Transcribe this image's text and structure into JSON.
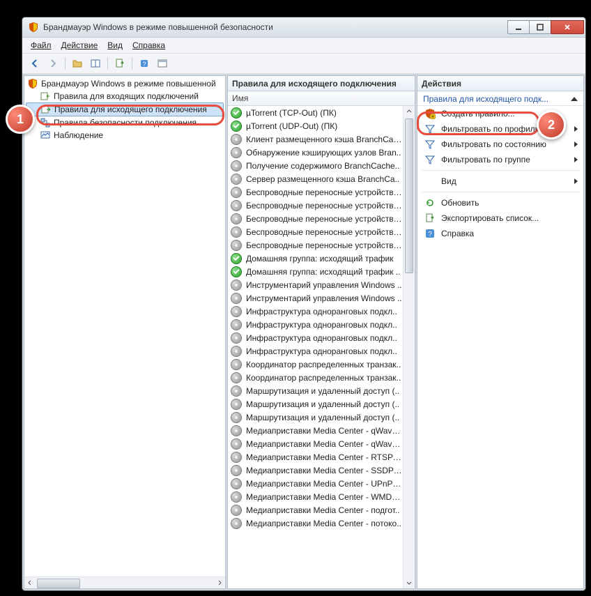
{
  "window": {
    "title": "Брандмауэр Windows в режиме повышенной безопасности"
  },
  "menu": {
    "file": "Файл",
    "action": "Действие",
    "view": "Вид",
    "help": "Справка"
  },
  "tree": {
    "root": "Брандмауэр Windows в режиме повышенной",
    "inbound": "Правила для входящих подключений",
    "outbound": "Правила для исходящего подключения",
    "connsec": "Правила безопасности подключения",
    "monitoring": "Наблюдение"
  },
  "list": {
    "header": "Правила для исходящего подключения",
    "column_name": "Имя",
    "rules": [
      {
        "name": "µTorrent (TCP-Out) (ПК)",
        "enabled": true
      },
      {
        "name": "µTorrent (UDP-Out) (ПК)",
        "enabled": true
      },
      {
        "name": "Клиент размещенного кэша BranchCac..",
        "enabled": false
      },
      {
        "name": "Обнаружение кэширующих узлов Bran..",
        "enabled": false
      },
      {
        "name": "Получение содержимого BranchCache..",
        "enabled": false
      },
      {
        "name": "Сервер размещенного кэша BranchCa..",
        "enabled": false
      },
      {
        "name": "Беспроводные переносные устройства..",
        "enabled": false
      },
      {
        "name": "Беспроводные переносные устройства..",
        "enabled": false
      },
      {
        "name": "Беспроводные переносные устройства..",
        "enabled": false
      },
      {
        "name": "Беспроводные переносные устройства..",
        "enabled": false
      },
      {
        "name": "Беспроводные переносные устройства..",
        "enabled": false
      },
      {
        "name": "Домашняя группа: исходящий трафик",
        "enabled": true
      },
      {
        "name": "Домашняя группа: исходящий трафик ..",
        "enabled": true
      },
      {
        "name": "Инструментарий управления Windows ..",
        "enabled": false
      },
      {
        "name": "Инструментарий управления Windows ..",
        "enabled": false
      },
      {
        "name": "Инфраструктура одноранговых подкл..",
        "enabled": false
      },
      {
        "name": "Инфраструктура одноранговых подкл..",
        "enabled": false
      },
      {
        "name": "Инфраструктура одноранговых подкл..",
        "enabled": false
      },
      {
        "name": "Инфраструктура одноранговых подкл..",
        "enabled": false
      },
      {
        "name": "Координатор распределенных транзак..",
        "enabled": false
      },
      {
        "name": "Координатор распределенных транзак..",
        "enabled": false
      },
      {
        "name": "Маршрутизация и удаленный доступ (..",
        "enabled": false
      },
      {
        "name": "Маршрутизация и удаленный доступ (..",
        "enabled": false
      },
      {
        "name": "Маршрутизация и удаленный доступ (..",
        "enabled": false
      },
      {
        "name": "Медиаприставки Media Center - qWave ..",
        "enabled": false
      },
      {
        "name": "Медиаприставки Media Center - qWave ..",
        "enabled": false
      },
      {
        "name": "Медиаприставки Media Center - RTSP (..",
        "enabled": false
      },
      {
        "name": "Медиаприставки Media Center - SSDP (..",
        "enabled": false
      },
      {
        "name": "Медиаприставки Media Center - UPnP (..",
        "enabled": false
      },
      {
        "name": "Медиаприставки Media Center - WMDR..",
        "enabled": false
      },
      {
        "name": "Медиаприставки Media Center - подгот..",
        "enabled": false
      },
      {
        "name": "Медиаприставки Media Center - потоко..",
        "enabled": false
      }
    ]
  },
  "actions": {
    "header": "Действия",
    "group_title": "Правила для исходящего подк...",
    "new_rule": "Создать правило...",
    "filter_profile": "Фильтровать по профилю",
    "filter_state": "Фильтровать по состоянию",
    "filter_group": "Фильтровать по группе",
    "view": "Вид",
    "refresh": "Обновить",
    "export": "Экспортировать список...",
    "help": "Справка"
  },
  "callouts": {
    "badge1": "1",
    "badge2": "2"
  }
}
